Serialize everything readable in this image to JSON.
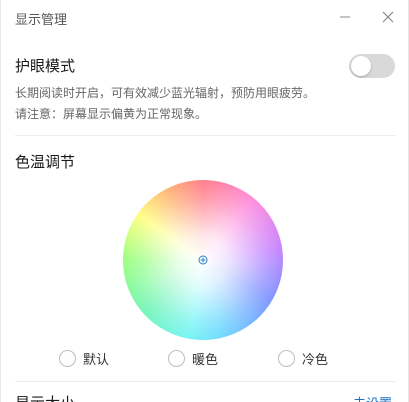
{
  "window": {
    "title": "显示管理"
  },
  "eye_care": {
    "title": "护眼模式",
    "enabled": false,
    "desc_line1": "长期阅读时开启，可有效减少蓝光辐射，预防用眼疲劳。",
    "desc_line2": "请注意：屏幕显示偏黄为正常现象。"
  },
  "color_temp": {
    "title": "色温调节",
    "options": [
      {
        "label": "默认",
        "selected": false
      },
      {
        "label": "暖色",
        "selected": false
      },
      {
        "label": "冷色",
        "selected": false
      }
    ]
  },
  "display_size": {
    "title": "显示大小",
    "link_label": "去设置"
  },
  "colors": {
    "link": "#1a73c8",
    "toggle_off": "#d9d9d9",
    "cursor": "#2a7fc4"
  },
  "icons": {
    "minimize": "minimize-icon",
    "close": "close-icon",
    "wheel_cursor": "crosshair-icon"
  }
}
